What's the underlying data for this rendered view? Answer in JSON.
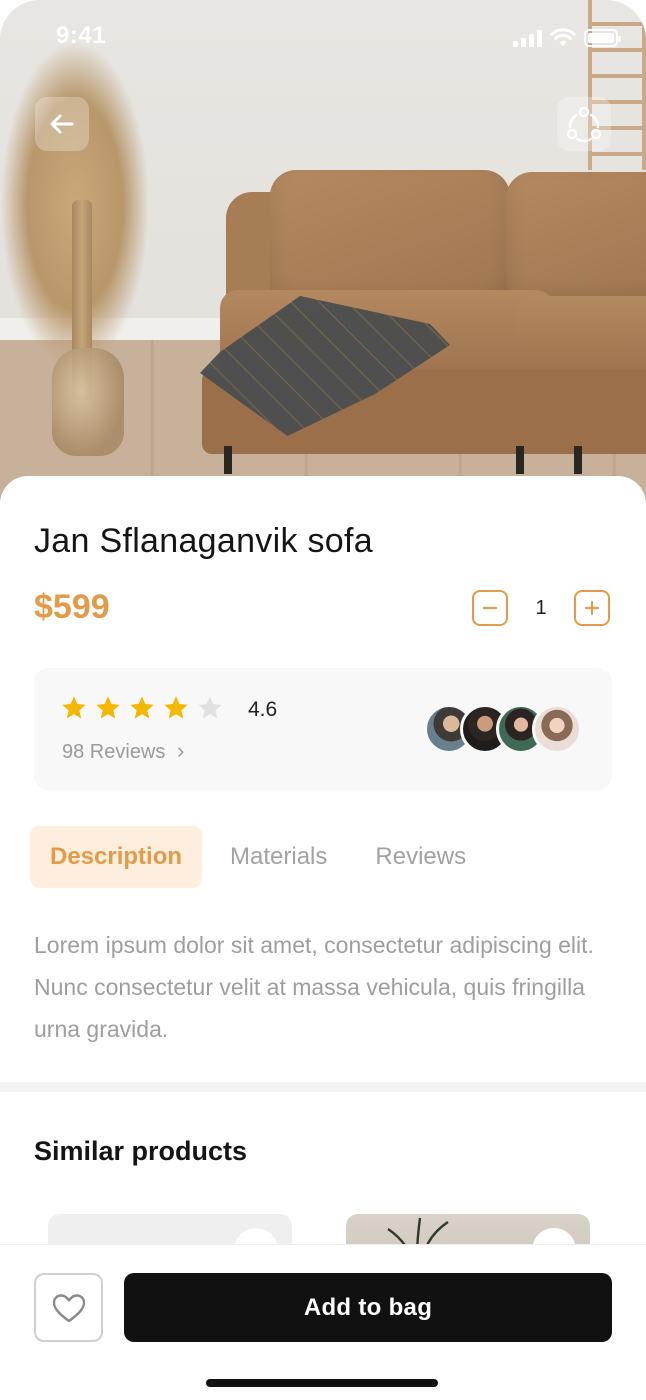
{
  "status_bar": {
    "time": "9:41"
  },
  "hero": {
    "back_icon": "arrow-left-icon",
    "share_icon": "share-icon"
  },
  "product": {
    "title": "Jan Sflanaganvik sofa",
    "price": "$599",
    "quantity": "1"
  },
  "rating": {
    "value": "4.6",
    "stars_filled": 4,
    "stars_total": 5,
    "reviews_label": "98 Reviews",
    "reviews_chevron": "›"
  },
  "tabs": [
    {
      "label": "Description",
      "active": true
    },
    {
      "label": "Materials",
      "active": false
    },
    {
      "label": "Reviews",
      "active": false
    }
  ],
  "description": "Lorem ipsum dolor sit amet, consectetur adipiscing elit. Nunc consectetur velit at massa vehicula, quis fringilla urna gravida.",
  "similar": {
    "title": "Similar products"
  },
  "bottom_bar": {
    "add_to_bag": "Add to bag",
    "fav_icon": "heart-icon"
  },
  "colors": {
    "accent": "#e39a49",
    "accent_bg": "#fdeedd",
    "star": "#f5b800",
    "button": "#111111"
  }
}
